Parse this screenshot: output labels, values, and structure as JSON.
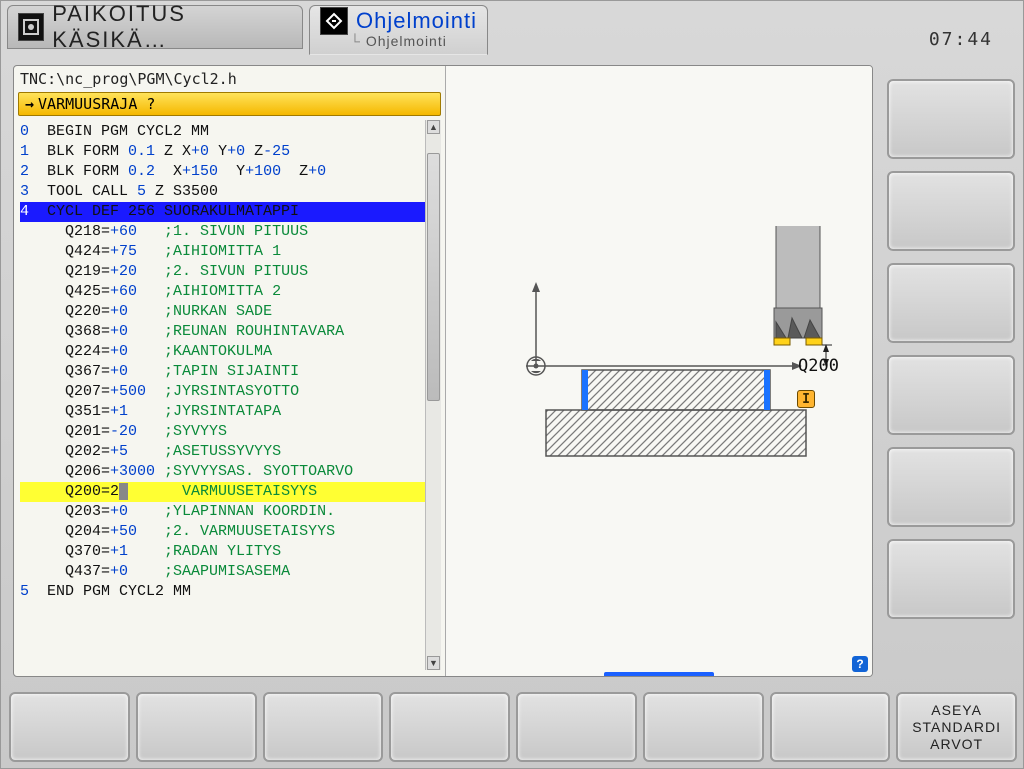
{
  "header": {
    "mode_left": "PAIKOITUS KÄSIKÄ…",
    "mode_right_title": "Ohjelmointi",
    "breadcrumb": "Ohjelmointi",
    "time": "07:44"
  },
  "editor": {
    "file_path": "TNC:\\nc_prog\\PGM\\Cycl2.h",
    "prompt": "VARMUUSRAJA ?",
    "lines": [
      {
        "n": "0",
        "tokens": [
          [
            "kw",
            " BEGIN PGM CYCL2 MM"
          ]
        ]
      },
      {
        "n": "1",
        "tokens": [
          [
            "kw",
            " BLK FORM "
          ],
          [
            "vblue",
            "0.1"
          ],
          [
            "kw",
            " Z X"
          ],
          [
            "vblue",
            "+0"
          ],
          [
            "kw",
            " Y"
          ],
          [
            "vblue",
            "+0"
          ],
          [
            "kw",
            " Z"
          ],
          [
            "vblue",
            "-25"
          ]
        ]
      },
      {
        "n": "2",
        "tokens": [
          [
            "kw",
            " BLK FORM "
          ],
          [
            "vblue",
            "0.2"
          ],
          [
            "kw",
            "  X"
          ],
          [
            "vblue",
            "+150"
          ],
          [
            "kw",
            "  Y"
          ],
          [
            "vblue",
            "+100"
          ],
          [
            "kw",
            "  Z"
          ],
          [
            "vblue",
            "+0"
          ]
        ]
      },
      {
        "n": "3",
        "tokens": [
          [
            "kw",
            " TOOL CALL "
          ],
          [
            "vblue",
            "5"
          ],
          [
            "kw",
            " Z S3500"
          ]
        ]
      },
      {
        "n": "4",
        "sel": true,
        "tokens": [
          [
            "kw",
            " CYCL DEF 256 SUORAKULMATAPPI"
          ]
        ]
      },
      {
        "n": "",
        "tokens": [
          [
            "kw",
            "   Q218="
          ],
          [
            "vblue",
            "+60"
          ],
          [
            "kw",
            "   "
          ],
          [
            "vgreen",
            ";1. SIVUN PITUUS"
          ]
        ]
      },
      {
        "n": "",
        "tokens": [
          [
            "kw",
            "   Q424="
          ],
          [
            "vblue",
            "+75"
          ],
          [
            "kw",
            "   "
          ],
          [
            "vgreen",
            ";AIHIOMITTA 1"
          ]
        ]
      },
      {
        "n": "",
        "tokens": [
          [
            "kw",
            "   Q219="
          ],
          [
            "vblue",
            "+20"
          ],
          [
            "kw",
            "   "
          ],
          [
            "vgreen",
            ";2. SIVUN PITUUS"
          ]
        ]
      },
      {
        "n": "",
        "tokens": [
          [
            "kw",
            "   Q425="
          ],
          [
            "vblue",
            "+60"
          ],
          [
            "kw",
            "   "
          ],
          [
            "vgreen",
            ";AIHIOMITTA 2"
          ]
        ]
      },
      {
        "n": "",
        "tokens": [
          [
            "kw",
            "   Q220="
          ],
          [
            "vblue",
            "+0"
          ],
          [
            "kw",
            "    "
          ],
          [
            "vgreen",
            ";NURKAN SADE"
          ]
        ]
      },
      {
        "n": "",
        "tokens": [
          [
            "kw",
            "   Q368="
          ],
          [
            "vblue",
            "+0"
          ],
          [
            "kw",
            "    "
          ],
          [
            "vgreen",
            ";REUNAN ROUHINTAVARA"
          ]
        ]
      },
      {
        "n": "",
        "tokens": [
          [
            "kw",
            "   Q224="
          ],
          [
            "vblue",
            "+0"
          ],
          [
            "kw",
            "    "
          ],
          [
            "vgreen",
            ";KAANTOKULMA"
          ]
        ]
      },
      {
        "n": "",
        "tokens": [
          [
            "kw",
            "   Q367="
          ],
          [
            "vblue",
            "+0"
          ],
          [
            "kw",
            "    "
          ],
          [
            "vgreen",
            ";TAPIN SIJAINTI"
          ]
        ]
      },
      {
        "n": "",
        "tokens": [
          [
            "kw",
            "   Q207="
          ],
          [
            "vblue",
            "+500"
          ],
          [
            "kw",
            "  "
          ],
          [
            "vgreen",
            ";JYRSINTASYOTTO"
          ]
        ]
      },
      {
        "n": "",
        "tokens": [
          [
            "kw",
            "   Q351="
          ],
          [
            "vblue",
            "+1"
          ],
          [
            "kw",
            "    "
          ],
          [
            "vgreen",
            ";JYRSINTATAPA"
          ]
        ]
      },
      {
        "n": "",
        "tokens": [
          [
            "kw",
            "   Q201="
          ],
          [
            "vblue",
            "-20"
          ],
          [
            "kw",
            "   "
          ],
          [
            "vgreen",
            ";SYVYYS"
          ]
        ]
      },
      {
        "n": "",
        "tokens": [
          [
            "kw",
            "   Q202="
          ],
          [
            "vblue",
            "+5"
          ],
          [
            "kw",
            "    "
          ],
          [
            "vgreen",
            ";ASETUSSYVYYS"
          ]
        ]
      },
      {
        "n": "",
        "tokens": [
          [
            "kw",
            "   Q206="
          ],
          [
            "vblue",
            "+3000"
          ],
          [
            "kw",
            " "
          ],
          [
            "vgreen",
            ";SYVYYSAS. SYOTTOARVO"
          ]
        ]
      },
      {
        "n": "",
        "hl": true,
        "tokens": [
          [
            "kw",
            "   Q200=2"
          ],
          [
            "cur",
            " "
          ],
          [
            "kw",
            "      "
          ],
          [
            "vgreen",
            "VARMUUSETAISYYS"
          ]
        ]
      },
      {
        "n": "",
        "tokens": [
          [
            "kw",
            "   Q203="
          ],
          [
            "vblue",
            "+0"
          ],
          [
            "kw",
            "    "
          ],
          [
            "vgreen",
            ";YLAPINNAN KOORDIN."
          ]
        ]
      },
      {
        "n": "",
        "tokens": [
          [
            "kw",
            "   Q204="
          ],
          [
            "vblue",
            "+50"
          ],
          [
            "kw",
            "   "
          ],
          [
            "vgreen",
            ";2. VARMUUSETAISYYS"
          ]
        ]
      },
      {
        "n": "",
        "tokens": [
          [
            "kw",
            "   Q370="
          ],
          [
            "vblue",
            "+1"
          ],
          [
            "kw",
            "    "
          ],
          [
            "vgreen",
            ";RADAN YLITYS"
          ]
        ]
      },
      {
        "n": "",
        "tokens": [
          [
            "kw",
            "   Q437="
          ],
          [
            "vblue",
            "+0"
          ],
          [
            "kw",
            "    "
          ],
          [
            "vgreen",
            ";SAAPUMISASEMA"
          ]
        ]
      },
      {
        "n": "5",
        "tokens": [
          [
            "kw",
            " END PGM CYCL2 MM"
          ]
        ]
      }
    ]
  },
  "graphic": {
    "dimension_label": "Q200",
    "info_badge": "I"
  },
  "softkeys": {
    "right": [
      "",
      "",
      "",
      "",
      "",
      ""
    ],
    "bottom": [
      "",
      "",
      "",
      "",
      "",
      "",
      "",
      "ASEYA\nSTANDARDI\nARVOT"
    ]
  }
}
